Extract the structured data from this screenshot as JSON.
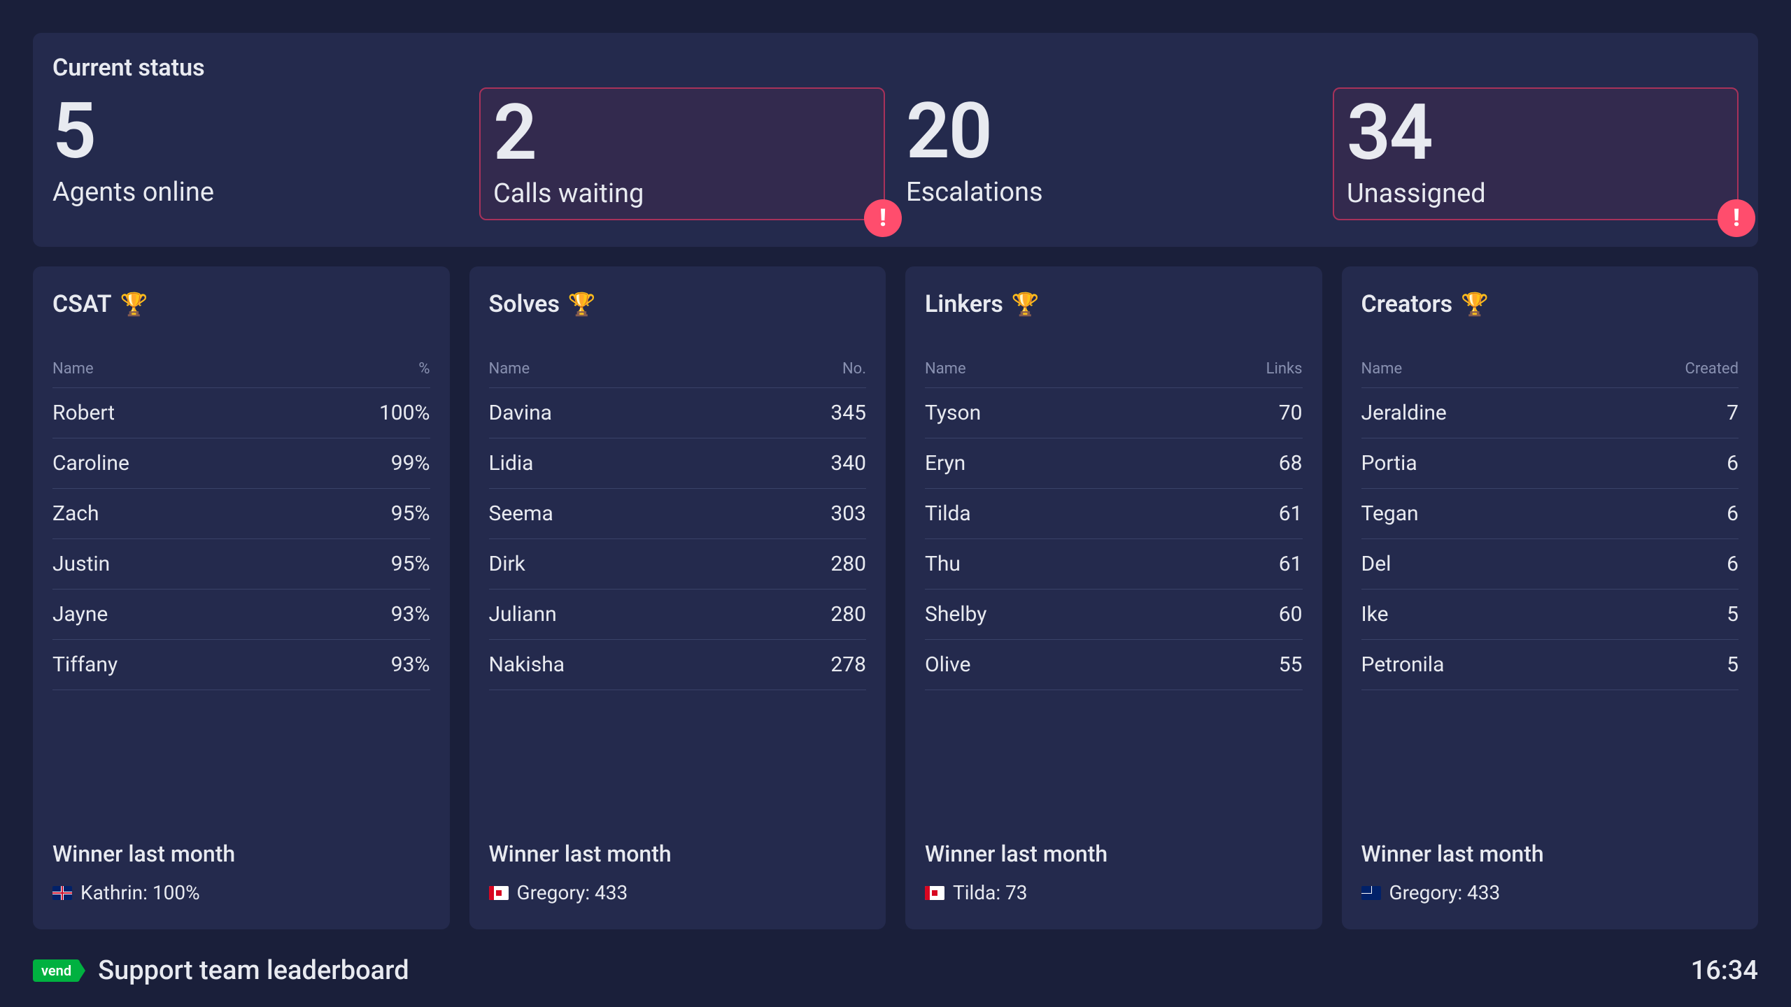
{
  "status": {
    "title": "Current status",
    "cards": [
      {
        "value": "5",
        "label": "Agents online",
        "alert": false
      },
      {
        "value": "2",
        "label": "Calls waiting",
        "alert": true
      },
      {
        "value": "20",
        "label": "Escalations",
        "alert": false
      },
      {
        "value": "34",
        "label": "Unassigned",
        "alert": true
      }
    ]
  },
  "boards": [
    {
      "title": "CSAT",
      "col1": "Name",
      "col2": "%",
      "rows": [
        {
          "name": "Robert",
          "value": "100%"
        },
        {
          "name": "Caroline",
          "value": "99%"
        },
        {
          "name": "Zach",
          "value": "95%"
        },
        {
          "name": "Justin",
          "value": "95%"
        },
        {
          "name": "Jayne",
          "value": "93%"
        },
        {
          "name": "Tiffany",
          "value": "93%"
        }
      ],
      "winner_label": "Winner last month",
      "winner_flag": "gb",
      "winner_text": "Kathrin: 100%"
    },
    {
      "title": "Solves",
      "col1": "Name",
      "col2": "No.",
      "rows": [
        {
          "name": "Davina",
          "value": "345"
        },
        {
          "name": "Lidia",
          "value": "340"
        },
        {
          "name": "Seema",
          "value": "303"
        },
        {
          "name": "Dirk",
          "value": "280"
        },
        {
          "name": "Juliann",
          "value": "280"
        },
        {
          "name": "Nakisha",
          "value": "278"
        }
      ],
      "winner_label": "Winner last month",
      "winner_flag": "ca",
      "winner_text": "Gregory: 433"
    },
    {
      "title": "Linkers",
      "col1": "Name",
      "col2": "Links",
      "rows": [
        {
          "name": "Tyson",
          "value": "70"
        },
        {
          "name": "Eryn",
          "value": "68"
        },
        {
          "name": "Tilda",
          "value": "61"
        },
        {
          "name": "Thu",
          "value": "61"
        },
        {
          "name": "Shelby",
          "value": "60"
        },
        {
          "name": "Olive",
          "value": "55"
        }
      ],
      "winner_label": "Winner last month",
      "winner_flag": "ca",
      "winner_text": "Tilda: 73"
    },
    {
      "title": "Creators",
      "col1": "Name",
      "col2": "Created",
      "rows": [
        {
          "name": "Jeraldine",
          "value": "7"
        },
        {
          "name": "Portia",
          "value": "6"
        },
        {
          "name": "Tegan",
          "value": "6"
        },
        {
          "name": "Del",
          "value": "6"
        },
        {
          "name": "Ike",
          "value": "5"
        },
        {
          "name": "Petronila",
          "value": "5"
        }
      ],
      "winner_label": "Winner last month",
      "winner_flag": "nz",
      "winner_text": "Gregory: 433"
    }
  ],
  "footer": {
    "brand": "vend",
    "title": "Support team leaderboard",
    "time": "16:34"
  },
  "icons": {
    "trophy": "🏆",
    "alert": "!"
  }
}
